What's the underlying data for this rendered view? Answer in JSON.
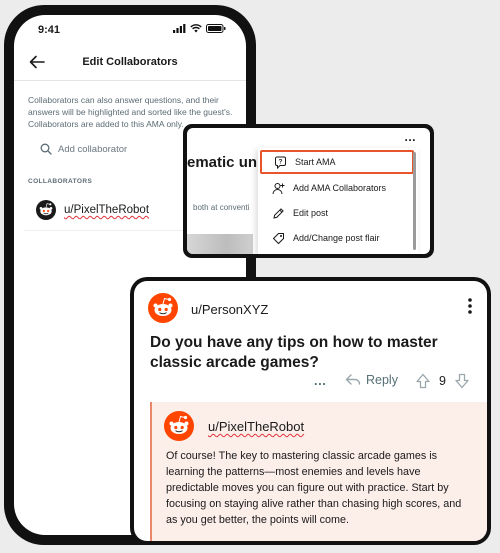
{
  "phone": {
    "status_time": "9:41",
    "nav_title": "Edit Collaborators",
    "info_text": "Collaborators can also answer questions, and their answers will be highlighted and sorted like the guest's. Collaborators are added to this AMA only.",
    "search_placeholder": "Add collaborator",
    "section_label": "COLLABORATORS",
    "collaborators": [
      {
        "username": "u/PixelTheRobot",
        "avatar_icon": "reddit-snoo-icon"
      }
    ],
    "icons": [
      "back-arrow-icon",
      "signal-icon",
      "wifi-icon",
      "battery-icon",
      "search-icon"
    ]
  },
  "menu_card": {
    "bg_title_fragment": "ematic uni",
    "bg_subtext_fragment": "both at conventi",
    "overflow_label": "...",
    "items": [
      {
        "label": "Start AMA",
        "icon": "question-bubble-icon",
        "highlighted": true
      },
      {
        "label": "Add AMA Collaborators",
        "icon": "add-user-icon",
        "highlighted": false
      },
      {
        "label": "Edit post",
        "icon": "pencil-icon",
        "highlighted": false
      },
      {
        "label": "Add/Change post flair",
        "icon": "tag-icon",
        "highlighted": false
      }
    ],
    "highlight_color": "#e8542b"
  },
  "post_card": {
    "author": "u/PersonXYZ",
    "title": "Do you have any tips on how to master classic arcade games?",
    "more_label": "...",
    "reply_label": "Reply",
    "vote_count": "9",
    "answer": {
      "author": "u/PixelTheRobot",
      "text": "Of course! The key to mastering classic arcade games is learning the patterns—most enemies and levels have predictable moves you can figure out with practice. Start by focusing on staying alive rather than chasing high scores, and as you get better, the points will come.",
      "background": "#fceee9",
      "accent": "#e98769"
    },
    "brand_color": "#ff4500"
  }
}
